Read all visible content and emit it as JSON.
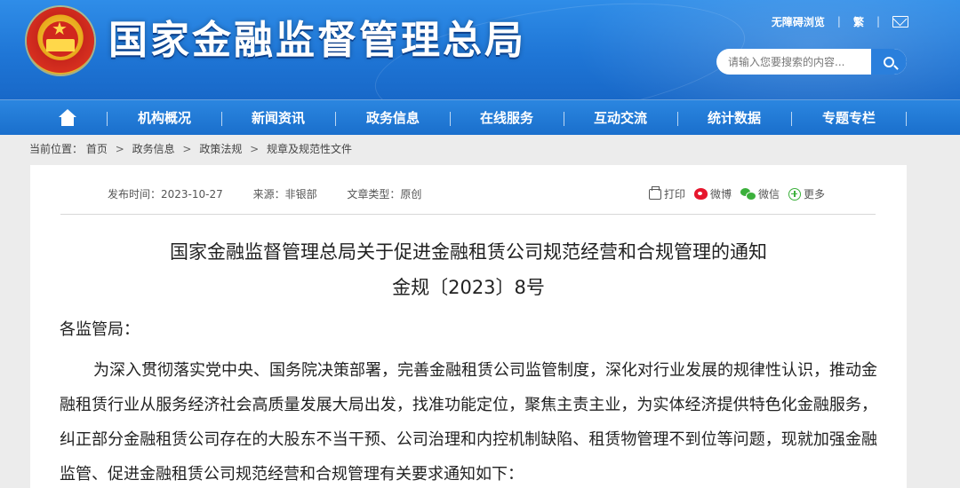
{
  "header": {
    "site_title": "国家金融监督管理总局",
    "accessibility_link": "无障碍浏览",
    "traditional_link": "繁",
    "mail_icon": "mail-icon",
    "emblem_icon": "national-emblem-icon",
    "search": {
      "placeholder": "请输入您要搜索的内容...",
      "icon": "search-icon"
    }
  },
  "nav": {
    "home_icon": "home-icon",
    "items": [
      {
        "label": "机构概况"
      },
      {
        "label": "新闻资讯"
      },
      {
        "label": "政务信息"
      },
      {
        "label": "在线服务"
      },
      {
        "label": "互动交流"
      },
      {
        "label": "统计数据"
      },
      {
        "label": "专题专栏"
      }
    ]
  },
  "breadcrumb": {
    "prefix": "当前位置：",
    "items": [
      "首页",
      "政务信息",
      "政策法规",
      "规章及规范性文件"
    ],
    "separator": ">"
  },
  "article": {
    "meta": {
      "publish_date": "发布时间：2023-10-27",
      "source": "来源：非银部",
      "type": "文章类型：原创"
    },
    "share": {
      "print": "打印",
      "weibo": "微博",
      "wechat": "微信",
      "more": "更多"
    },
    "title": "国家金融监督管理总局关于促进金融租赁公司规范经营和合规管理的通知",
    "doc_number": "金规〔2023〕8号",
    "salutation": "各监管局：",
    "paragraph": "为深入贯彻落实党中央、国务院决策部署，完善金融租赁公司监管制度，深化对行业发展的规律性认识，推动金融租赁行业从服务经济社会高质量发展大局出发，找准功能定位，聚焦主责主业，为实体经济提供特色化金融服务，纠正部分金融租赁公司存在的大股东不当干预、公司治理和内控机制缺陷、租赁物管理不到位等问题，现就加强金融监管、促进金融租赁公司规范经营和合规管理有关要求通知如下："
  }
}
